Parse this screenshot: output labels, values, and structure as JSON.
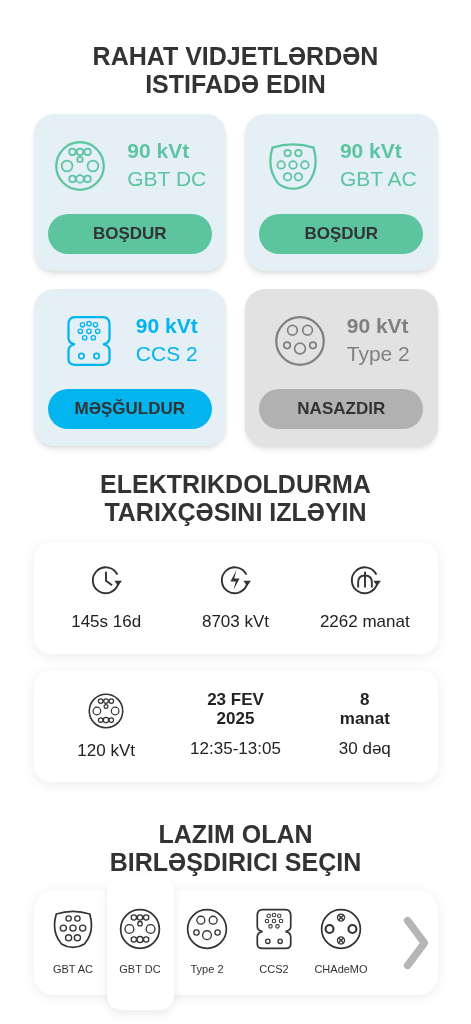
{
  "widgets_title": "RAHAT VIDJETLƏRDƏN ISTIFADƏ EDIN",
  "stations": [
    {
      "kind": "gbt_dc",
      "power": "90 kVt",
      "name": "GBT DC",
      "color": "#5cc59f",
      "disabled": false,
      "status_label": "BOŞDUR"
    },
    {
      "kind": "gbt_ac",
      "power": "90 kVt",
      "name": "GBT AC",
      "color": "#5cc59f",
      "disabled": false,
      "status_label": "BOŞDUR"
    },
    {
      "kind": "ccs2",
      "power": "90 kVt",
      "name": "CCS 2",
      "color": "#03b5ef",
      "disabled": false,
      "status_label": "MƏŞĞULDUR"
    },
    {
      "kind": "type2",
      "power": "90 kVt",
      "name": "Type 2",
      "color": "#808080",
      "disabled": true,
      "status_label": "NASAZDIR"
    }
  ],
  "history_title": "ELEKTRIKDOLDURMA TARIXÇƏSINI IZLƏYIN",
  "totals": [
    {
      "kind": "time",
      "value": "145s 16d"
    },
    {
      "kind": "energy",
      "value": "8703 kVt"
    },
    {
      "kind": "money",
      "value": "2262 manat"
    }
  ],
  "session": {
    "kind": "gbt_dc",
    "power": "120 kVt",
    "date": "23 FEV 2025",
    "time": "12:35-13:05",
    "cost": "8 manat",
    "duration": "30 dəq"
  },
  "connectors_title": "LAZIM OLAN BIRLƏŞDIRICI SEÇIN",
  "connectors": [
    {
      "kind": "gbt_ac",
      "label": "GBT AC",
      "selected": false
    },
    {
      "kind": "gbt_dc",
      "label": "GBT DC",
      "selected": true
    },
    {
      "kind": "type2",
      "label": "Type 2",
      "selected": false
    },
    {
      "kind": "ccs2",
      "label": "CCS2",
      "selected": false
    },
    {
      "kind": "chademo",
      "label": "CHAdeMO",
      "selected": false
    }
  ]
}
